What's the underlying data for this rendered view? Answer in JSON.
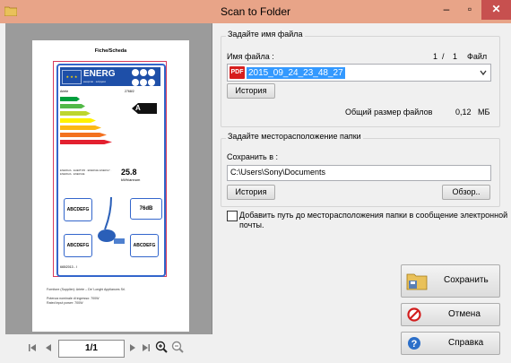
{
  "window": {
    "title": "Scan to Folder",
    "min_glyph": "–",
    "max_glyph": "▫",
    "close_glyph": "✕"
  },
  "preview": {
    "page_header": "Fiche/Scheda",
    "label": {
      "energy_word": "ENERG",
      "energy_sub": "енергия · ενέργεια",
      "flag_stars": "★ ★ ★",
      "brand": "Ariete",
      "model": "2768/2",
      "class": "A",
      "consumption": "25.8",
      "consumption_unit": "kWh/annum",
      "small_text": "ENERGIA · ЕНЕРГИЯ · ENERGIE ENERGY · ENERGIA · ENERGIE",
      "rating_top_left": "ABCDEFG",
      "noise": "76dB",
      "rating_bottom_left": "ABCDEFG",
      "rating_bottom_right": "ABCDEFG",
      "footer": "665/2013 - I"
    },
    "notes": [
      "Fornitore (Supplier): Ariete – De' Longhi Appliances Srl.",
      "Potenza nominale di ingresso: 700W",
      "Rated input power: 700W"
    ],
    "page_indicator": "1/1",
    "nav_icons": [
      "first-page-icon",
      "prev-page-icon",
      "next-page-icon",
      "last-page-icon",
      "zoom-in-icon",
      "zoom-out-icon"
    ]
  },
  "filename_group": {
    "title": "Задайте имя файла",
    "field_label": "Имя файла :",
    "page_current": "1",
    "page_sep": "/",
    "page_total": "1",
    "page_unit": "Файл",
    "file_type_icon": "PDF",
    "value": "2015_09_24_23_48_27",
    "history_button": "История",
    "total_size_label": "Общий размер файлов",
    "total_size_value": "0,12",
    "total_size_unit": "МБ"
  },
  "location_group": {
    "title": "Задайте месторасположение папки",
    "field_label": "Сохранить в :",
    "path": "C:\\Users\\Sony\\Documents",
    "history_button": "История",
    "browse_button": "Обзор.."
  },
  "add_path_checkbox": {
    "checked": false,
    "label_line1": "Добавить путь до месторасположения папки в сообщение электронной",
    "label_line2": "почты."
  },
  "actions": {
    "save": "Сохранить",
    "cancel": "Отмена",
    "help": "Справка"
  },
  "colors": {
    "titlebar": "#e8a488",
    "close": "#c7504f",
    "selection": "#3399ff",
    "energy_bars": [
      "#009f3c",
      "#52b948",
      "#bdd62e",
      "#fff200",
      "#fcb814",
      "#f3711f",
      "#e3202f"
    ]
  }
}
